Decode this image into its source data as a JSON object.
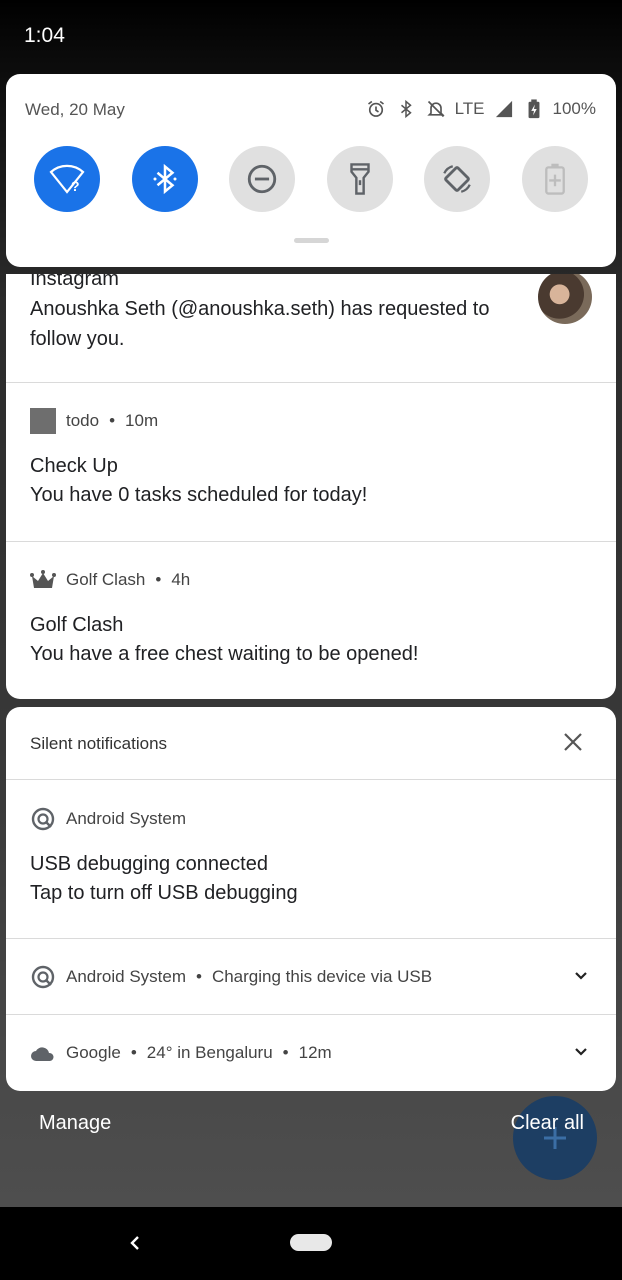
{
  "status_bar": {
    "time": "1:04"
  },
  "quick_settings": {
    "date": "Wed, 20 May",
    "network": "LTE",
    "battery": "100%",
    "tiles": [
      {
        "name": "wifi",
        "icon": "wifi-unknown-icon",
        "active": true
      },
      {
        "name": "bluetooth",
        "icon": "bluetooth-icon",
        "active": true
      },
      {
        "name": "do-not-disturb",
        "icon": "dnd-icon",
        "active": false
      },
      {
        "name": "flashlight",
        "icon": "flashlight-icon",
        "active": false
      },
      {
        "name": "auto-rotate",
        "icon": "rotate-icon",
        "active": false
      },
      {
        "name": "battery-saver",
        "icon": "battery-saver-icon",
        "active": false
      }
    ]
  },
  "notifications": {
    "instagram": {
      "app": "Instagram",
      "body": "Anoushka Seth (@anoushka.seth) has requested to follow you."
    },
    "todo": {
      "app": "todo",
      "time": "10m",
      "title": "Check Up",
      "body": "You have 0 tasks scheduled for today!"
    },
    "golf": {
      "app": "Golf Clash",
      "time": "4h",
      "title": "Golf Clash",
      "body": "You have a free chest waiting to be opened!"
    }
  },
  "silent": {
    "header": "Silent notifications",
    "usb_debug": {
      "app": "Android System",
      "title": "USB debugging connected",
      "body": "Tap to turn off USB debugging"
    },
    "charging": {
      "app": "Android System",
      "text": "Charging this device via USB"
    },
    "weather": {
      "app": "Google",
      "text": "24° in Bengaluru",
      "time": "12m"
    }
  },
  "footer": {
    "manage": "Manage",
    "clear_all": "Clear all"
  },
  "colors": {
    "accent": "#1a73e8",
    "card": "#ffffff",
    "fab": "#1d3e63"
  }
}
